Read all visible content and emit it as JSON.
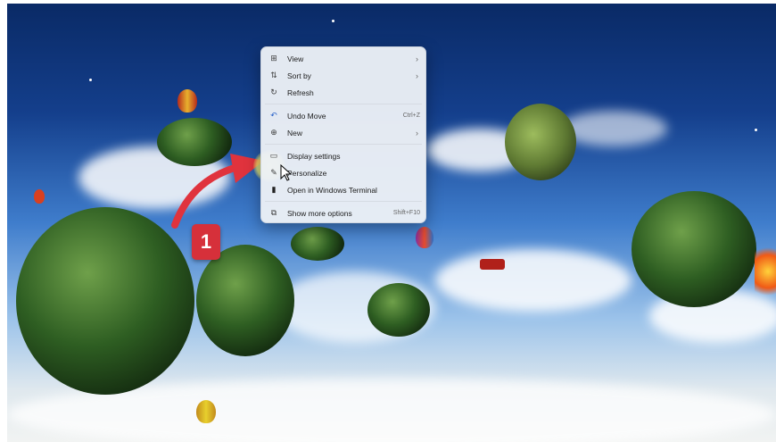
{
  "context_menu": {
    "items": [
      {
        "label": "View",
        "icon": "view-grid-icon",
        "glyph": "⊞",
        "has_submenu": true,
        "shortcut": ""
      },
      {
        "label": "Sort by",
        "icon": "sort-icon",
        "glyph": "⇅",
        "has_submenu": true,
        "shortcut": ""
      },
      {
        "label": "Refresh",
        "icon": "refresh-icon",
        "glyph": "↻",
        "has_submenu": false,
        "shortcut": ""
      },
      {
        "label": "Undo Move",
        "icon": "undo-icon",
        "glyph": "↶",
        "has_submenu": false,
        "shortcut": "Ctrl+Z"
      },
      {
        "label": "New",
        "icon": "new-plus-icon",
        "glyph": "⊕",
        "has_submenu": true,
        "shortcut": ""
      },
      {
        "label": "Display settings",
        "icon": "display-settings-icon",
        "glyph": "▭",
        "has_submenu": false,
        "shortcut": ""
      },
      {
        "label": "Personalize",
        "icon": "personalize-brush-icon",
        "glyph": "✎",
        "has_submenu": false,
        "shortcut": ""
      },
      {
        "label": "Open in Windows Terminal",
        "icon": "terminal-icon",
        "glyph": "▮",
        "has_submenu": false,
        "shortcut": ""
      },
      {
        "label": "Show more options",
        "icon": "more-options-icon",
        "glyph": "⧉",
        "has_submenu": false,
        "shortcut": "Shift+F10"
      }
    ],
    "submenu_arrow": "›"
  },
  "annotation": {
    "step_number": "1",
    "color": "#d6303a"
  },
  "colors": {
    "menu_bg": "#ecf0f6",
    "accent_arrow": "#e0333d",
    "cursor_highlight": "#f5f27a"
  }
}
